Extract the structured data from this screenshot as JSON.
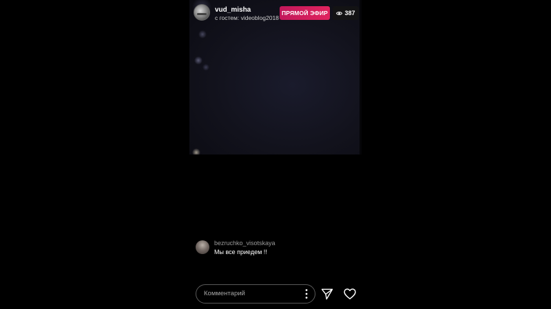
{
  "stream": {
    "username": "vud_misha",
    "guest_text": "с гостем: videoblog2018",
    "live_label": "ПРЯМОЙ ЭФИР",
    "viewer_count": "387",
    "avatar_icon": "user-avatar",
    "eye_icon": "eye-icon"
  },
  "comments": [
    {
      "user": "bezruchko_visotskaya",
      "text": "Мы все приедем !!"
    }
  ],
  "footer": {
    "comment_placeholder": "Комментарий",
    "more_icon": "more-icon",
    "send_icon": "send-icon",
    "like_icon": "heart-icon"
  },
  "colors": {
    "live_badge": "#e0245e",
    "background": "#000000"
  }
}
